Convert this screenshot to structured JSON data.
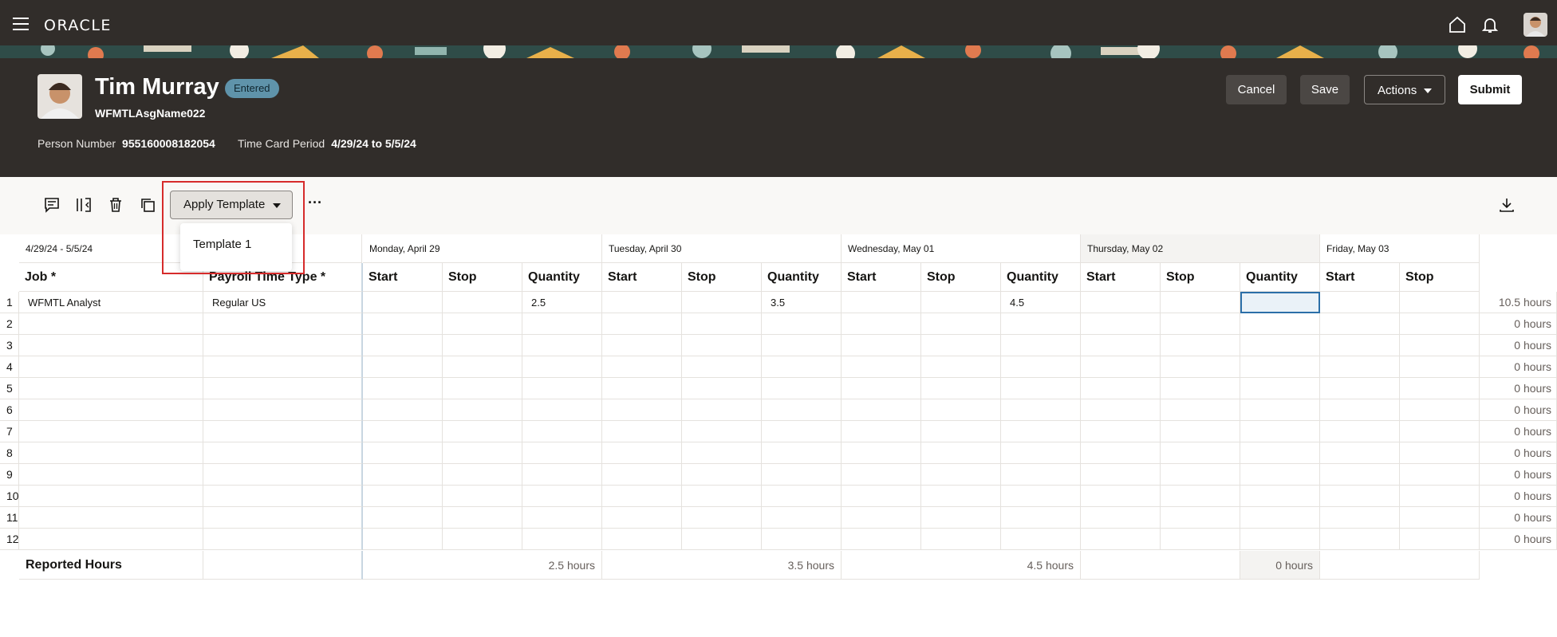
{
  "app": {
    "logo": "ORACLE"
  },
  "person": {
    "name": "Tim Murray",
    "status": "Entered",
    "assignment": "WFMTLAsgName022",
    "person_number_label": "Person Number",
    "person_number": "955160008182054",
    "period_label": "Time Card Period",
    "period": "4/29/24 to 5/5/24"
  },
  "header_buttons": {
    "cancel": "Cancel",
    "save": "Save",
    "actions": "Actions",
    "submit": "Submit"
  },
  "toolbar": {
    "apply_template": "Apply Template",
    "more": "···"
  },
  "template_menu": {
    "items": [
      "Template 1"
    ]
  },
  "grid": {
    "period_range": "4/29/24 - 5/5/24",
    "days": [
      "Monday, April 29",
      "Tuesday, April 30",
      "Wednesday, May 01",
      "Thursday, May 02",
      "Friday, May 03"
    ],
    "headers": {
      "job": "Job *",
      "payroll_time_type": "Payroll Time Type *",
      "start": "Start",
      "stop": "Stop",
      "quantity": "Quantity"
    },
    "rows": [
      {
        "num": "1",
        "job": "WFMTL Analyst",
        "type": "Regular US",
        "q": [
          "2.5",
          "3.5",
          "4.5",
          ""
        ],
        "total": "10.5 hours"
      },
      {
        "num": "2",
        "total": "0 hours"
      },
      {
        "num": "3",
        "total": "0 hours"
      },
      {
        "num": "4",
        "total": "0 hours"
      },
      {
        "num": "5",
        "total": "0 hours"
      },
      {
        "num": "6",
        "total": "0 hours"
      },
      {
        "num": "7",
        "total": "0 hours"
      },
      {
        "num": "8",
        "total": "0 hours"
      },
      {
        "num": "9",
        "total": "0 hours"
      },
      {
        "num": "10",
        "total": "0 hours"
      },
      {
        "num": "11",
        "total": "0 hours"
      },
      {
        "num": "12",
        "total": "0 hours"
      }
    ],
    "footer": {
      "label": "Reported Hours",
      "values": [
        "2.5 hours",
        "3.5 hours",
        "4.5 hours",
        "0 hours"
      ]
    }
  },
  "icons": {
    "menu": "hamburger-icon",
    "home": "home-icon",
    "notifications": "bell-icon",
    "comment": "comment-icon",
    "columns": "columns-icon",
    "delete": "delete-icon",
    "copy": "copy-icon",
    "download": "download-icon"
  },
  "colors": {
    "header_bg": "#312d2a",
    "status_badge": "#5f93aa",
    "highlight": "#d62b2b"
  }
}
